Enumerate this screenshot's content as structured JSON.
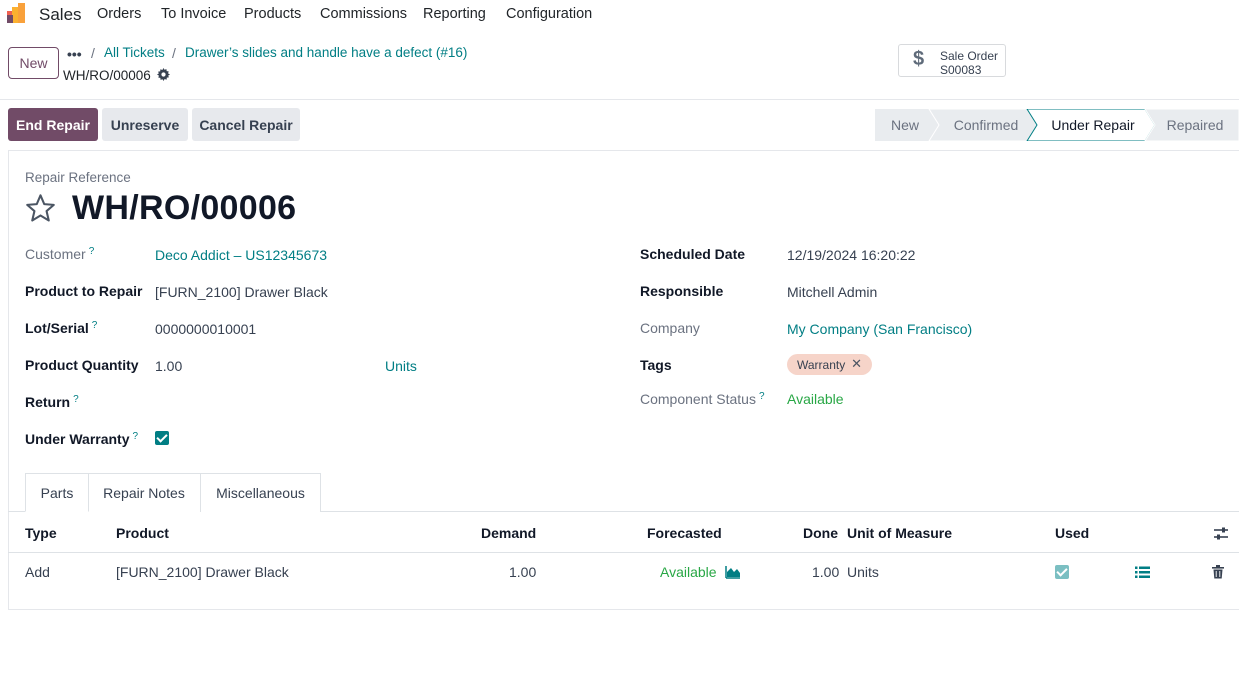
{
  "topnav": {
    "app_name": "Sales",
    "menu": [
      "Orders",
      "To Invoice",
      "Products",
      "Commissions",
      "Reporting",
      "Configuration"
    ]
  },
  "control": {
    "new_label": "New",
    "breadcrumbs": [
      "All Tickets",
      "Drawer’s slides and handle have a defect (#16)"
    ],
    "record_name": "WH/RO/00006",
    "smart_button": {
      "title": "Sale Order",
      "value": "S00083"
    }
  },
  "actions": {
    "end_repair": "End Repair",
    "unreserve": "Unreserve",
    "cancel_repair": "Cancel Repair"
  },
  "statusbar": {
    "stages": [
      "New",
      "Confirmed",
      "Under Repair",
      "Repaired"
    ],
    "current": "Under Repair"
  },
  "form": {
    "ref_label": "Repair Reference",
    "ref_value": "WH/RO/00006",
    "left": {
      "customer_label": "Customer",
      "customer_value": "Deco Addict – US12345673",
      "product_label": "Product to Repair",
      "product_value": "[FURN_2100] Drawer Black",
      "lot_label": "Lot/Serial",
      "lot_value": "0000000010001",
      "qty_label": "Product Quantity",
      "qty_value": "1.00",
      "qty_uom": "Units",
      "return_label": "Return",
      "warranty_label": "Under Warranty",
      "warranty_checked": true
    },
    "right": {
      "date_label": "Scheduled Date",
      "date_value": "12/19/2024 16:20:22",
      "resp_label": "Responsible",
      "resp_value": "Mitchell Admin",
      "company_label": "Company",
      "company_value": "My Company (San Francisco)",
      "tags_label": "Tags",
      "tag_value": "Warranty",
      "comp_label": "Component Status",
      "comp_value": "Available"
    },
    "help_mark": "?"
  },
  "tabs": [
    "Parts",
    "Repair Notes",
    "Miscellaneous"
  ],
  "parts_table": {
    "headers": {
      "type": "Type",
      "product": "Product",
      "demand": "Demand",
      "forecasted": "Forecasted",
      "done": "Done",
      "uom": "Unit of Measure",
      "used": "Used"
    },
    "rows": [
      {
        "type": "Add",
        "product": "[FURN_2100] Drawer Black",
        "demand": "1.00",
        "forecasted": "Available",
        "done": "1.00",
        "uom": "Units",
        "used": true
      }
    ]
  },
  "colors": {
    "brand": "#714b67",
    "link": "#017e84",
    "available": "#28a745",
    "tag_bg": "#f6d4c9"
  }
}
